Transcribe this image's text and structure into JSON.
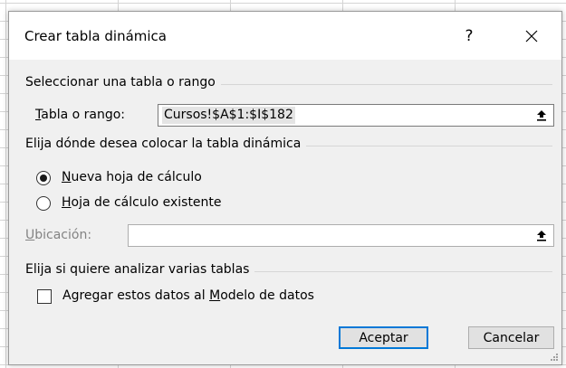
{
  "dialog": {
    "title": "Crear tabla dinámica",
    "help_label": "?",
    "group_source": "Seleccionar una tabla o rango",
    "range_label_key": "T",
    "range_label_rest": "abla o rango:",
    "range_value": "Cursos!$A$1:$I$182",
    "group_destination": "Elija dónde desea colocar la tabla dinámica",
    "new_sheet_key": "N",
    "new_sheet_rest": "ueva hoja de cálculo",
    "existing_sheet_key": "H",
    "existing_sheet_rest": "oja de cálculo existente",
    "location_key": "U",
    "location_rest": "bicación:",
    "location_value": "",
    "group_multiple": "Elija si quiere analizar varias tablas",
    "datamodel_pre": "Agregar estos datos al ",
    "datamodel_key": "M",
    "datamodel_post": "odelo de datos",
    "ok_label": "Aceptar",
    "cancel_label": "Cancelar",
    "new_sheet_selected": true,
    "existing_sheet_selected": false,
    "datamodel_checked": false
  },
  "icons": {
    "close": "close-icon",
    "collapse": "collapse-dialog-icon",
    "resize": "resize-grip-icon"
  },
  "colors": {
    "dialog_bg": "#f0f0f0",
    "default_button_border": "#0078d7"
  }
}
